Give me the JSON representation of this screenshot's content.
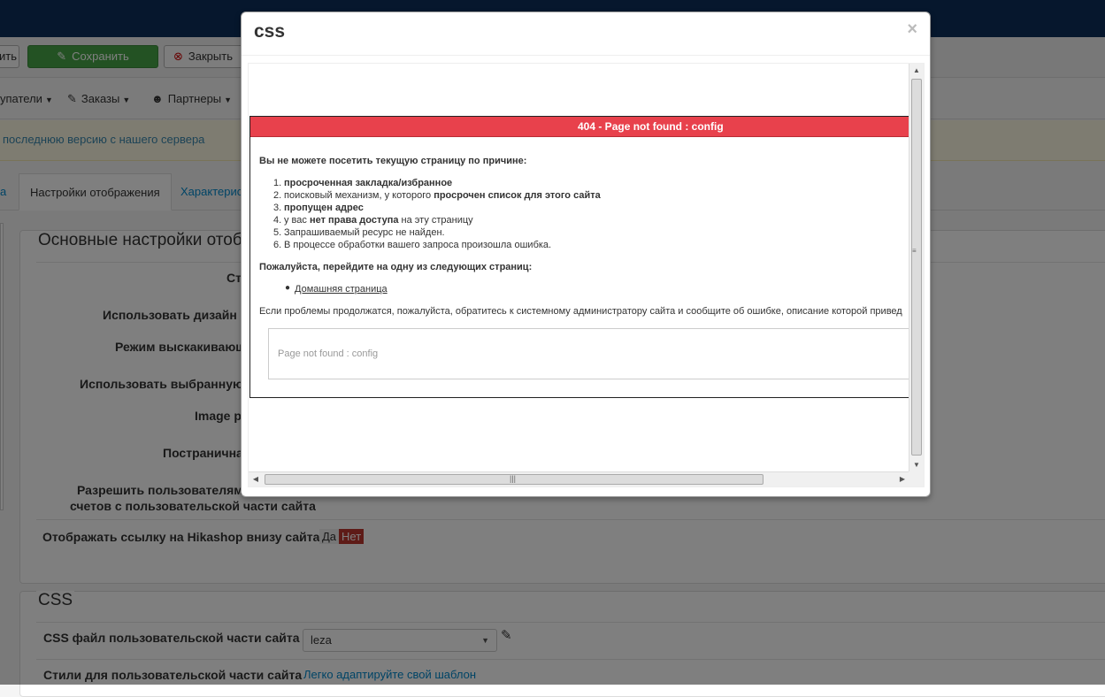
{
  "background": {
    "toolbar": {
      "btn_partial_label": "ить",
      "save_label": "Сохранить",
      "close_label": "Закрыть"
    },
    "menu": [
      {
        "label": "упатели"
      },
      {
        "label": "Заказы"
      },
      {
        "label": "Партнеры"
      }
    ],
    "notice": "последнюю версию с нашего сервера",
    "tabs": {
      "prev": "а",
      "active": "Настройки отображения",
      "next": "Характерис"
    },
    "section_main": {
      "legend": "Основные настройки отоб",
      "rows": [
        {
          "label": "Сти"
        },
        {
          "label": "Использовать дизайн н"
        },
        {
          "label": "Режим выскакивающ"
        },
        {
          "label": "Использовать выбранную"
        },
        {
          "label": "Image p"
        },
        {
          "label": "Постранична"
        },
        {
          "label": "Разрешить пользователям"
        },
        {
          "label": "счетов с пользовательской части сайта"
        },
        {
          "label": "Отображать ссылку на Hikashop внизу сайта"
        }
      ],
      "yes": "Да",
      "no": "Нет"
    },
    "section_css": {
      "legend": "CSS",
      "css_file_label": "CSS файл пользовательской части сайта",
      "css_file_value": "leza",
      "styles_label": "Стили для пользовательской части сайта",
      "styles_link": "Легко адаптируйте свой шаблон"
    }
  },
  "modal": {
    "title": "css",
    "close": "×",
    "error": {
      "bar": "404 - Page not found : config",
      "reason_heading": "Вы не можете посетить текущую страницу по причине:",
      "reasons": [
        {
          "num": "1.",
          "bold_a": "просроченная закладка/избранное",
          "text_b": "",
          "bold_c": "",
          "text_d": ""
        },
        {
          "num": "2.",
          "bold_a": "",
          "text_b": "поисковый механизм, у которого ",
          "bold_c": "просрочен список для этого сайта",
          "text_d": ""
        },
        {
          "num": "3.",
          "bold_a": "пропущен адрес",
          "text_b": "",
          "bold_c": "",
          "text_d": ""
        },
        {
          "num": "4.",
          "bold_a": "",
          "text_b": "у вас ",
          "bold_c": "нет права доступа",
          "text_d": " на эту страницу"
        },
        {
          "num": "5.",
          "bold_a": "",
          "text_b": "Запрашиваемый ресурс не найден.",
          "bold_c": "",
          "text_d": ""
        },
        {
          "num": "6.",
          "bold_a": "",
          "text_b": "В процессе обработки вашего запроса произошла ошибка.",
          "bold_c": "",
          "text_d": ""
        }
      ],
      "goto_heading": "Пожалуйста, перейдите на одну из следующих страниц:",
      "home_link": "Домашняя страница",
      "contact_text": "Если проблемы продолжатся, пожалуйста, обратитесь к системному администратору сайта и сообщите об ошибке, описание которой привед",
      "message": "Page not found : config"
    }
  }
}
